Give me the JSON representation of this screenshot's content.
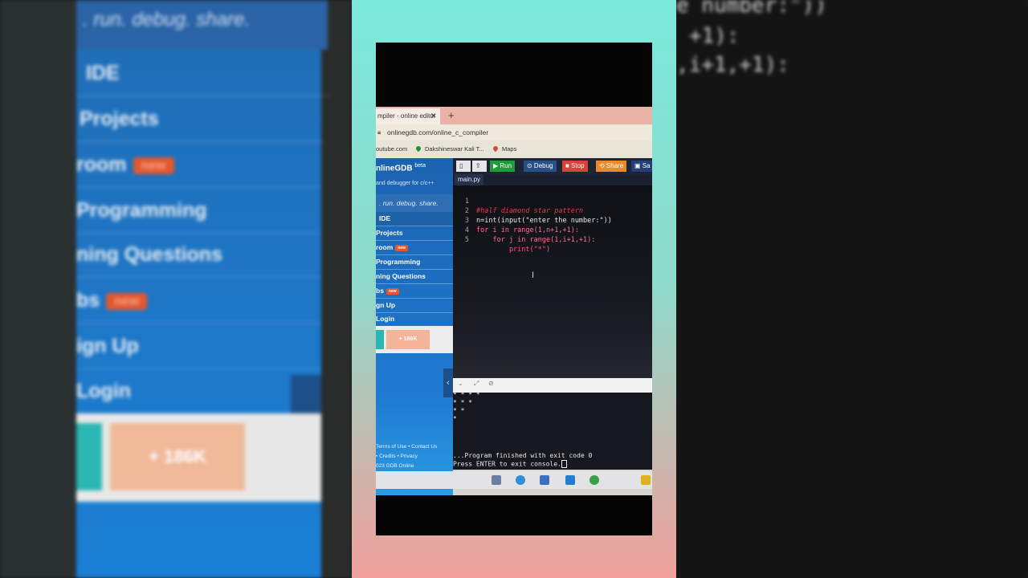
{
  "side_left": {
    "motto": ". run. debug. share.",
    "items": [
      {
        "label": "IDE"
      },
      {
        "label": "Projects"
      },
      {
        "label": "room",
        "badge": "new"
      },
      {
        "label": "Programming"
      },
      {
        "label": "ning Questions"
      },
      {
        "label": "bs",
        "badge": "new"
      },
      {
        "label": "ign Up"
      },
      {
        "label": "Login"
      }
    ],
    "count_button": "+ 186K"
  },
  "side_right": {
    "code_line_1": "e number:\"))",
    "code_line_2": "+1):",
    "code_line_3": ",i+1,+1):"
  },
  "browser": {
    "tab_title": "mpiler - online editor",
    "url": "onlinegdb.com/online_c_compiler",
    "bookmarks": [
      "outube.com",
      "Dakshineswar Kali T...",
      "Maps"
    ]
  },
  "gdb": {
    "logo": "nlineGDB",
    "logo_sup": "beta",
    "tagline": "and debugger for c/c++",
    "motto": ". run. debug. share.",
    "nav": [
      {
        "label": "IDE"
      },
      {
        "label": "Projects"
      },
      {
        "label": "room",
        "badge": "new"
      },
      {
        "label": "Programming"
      },
      {
        "label": "ning Questions"
      },
      {
        "label": "bs",
        "badge": "new"
      },
      {
        "label": "gn Up"
      },
      {
        "label": "Login"
      }
    ],
    "count_button": "+ 186K",
    "footer": [
      "Terms of Use • Contact Us",
      "• Credits • Privacy",
      "023 GDB Online"
    ]
  },
  "toolbar": {
    "run": "▶ Run",
    "debug": "⊙ Debug",
    "stop": "■ Stop",
    "share": "⟲ Share",
    "save": "▣ Sa"
  },
  "editor": {
    "file_tab": "main.py",
    "lines": [
      {
        "num": "1",
        "text": "#half diamond star pattern"
      },
      {
        "num": "2",
        "text": "n=int(input(\"enter the number:\"))"
      },
      {
        "num": "3",
        "text": "for i in range(1,n+1,+1):"
      },
      {
        "num": "4",
        "text": "    for j in range(1,i+1,+1):"
      },
      {
        "num": "5",
        "text": "        print(\"*\")"
      }
    ]
  },
  "console": {
    "output": [
      "* * * *",
      "* * *",
      "* *",
      "*"
    ],
    "finished": "...Program finished with exit code 0",
    "prompt": "Press ENTER to exit console."
  }
}
